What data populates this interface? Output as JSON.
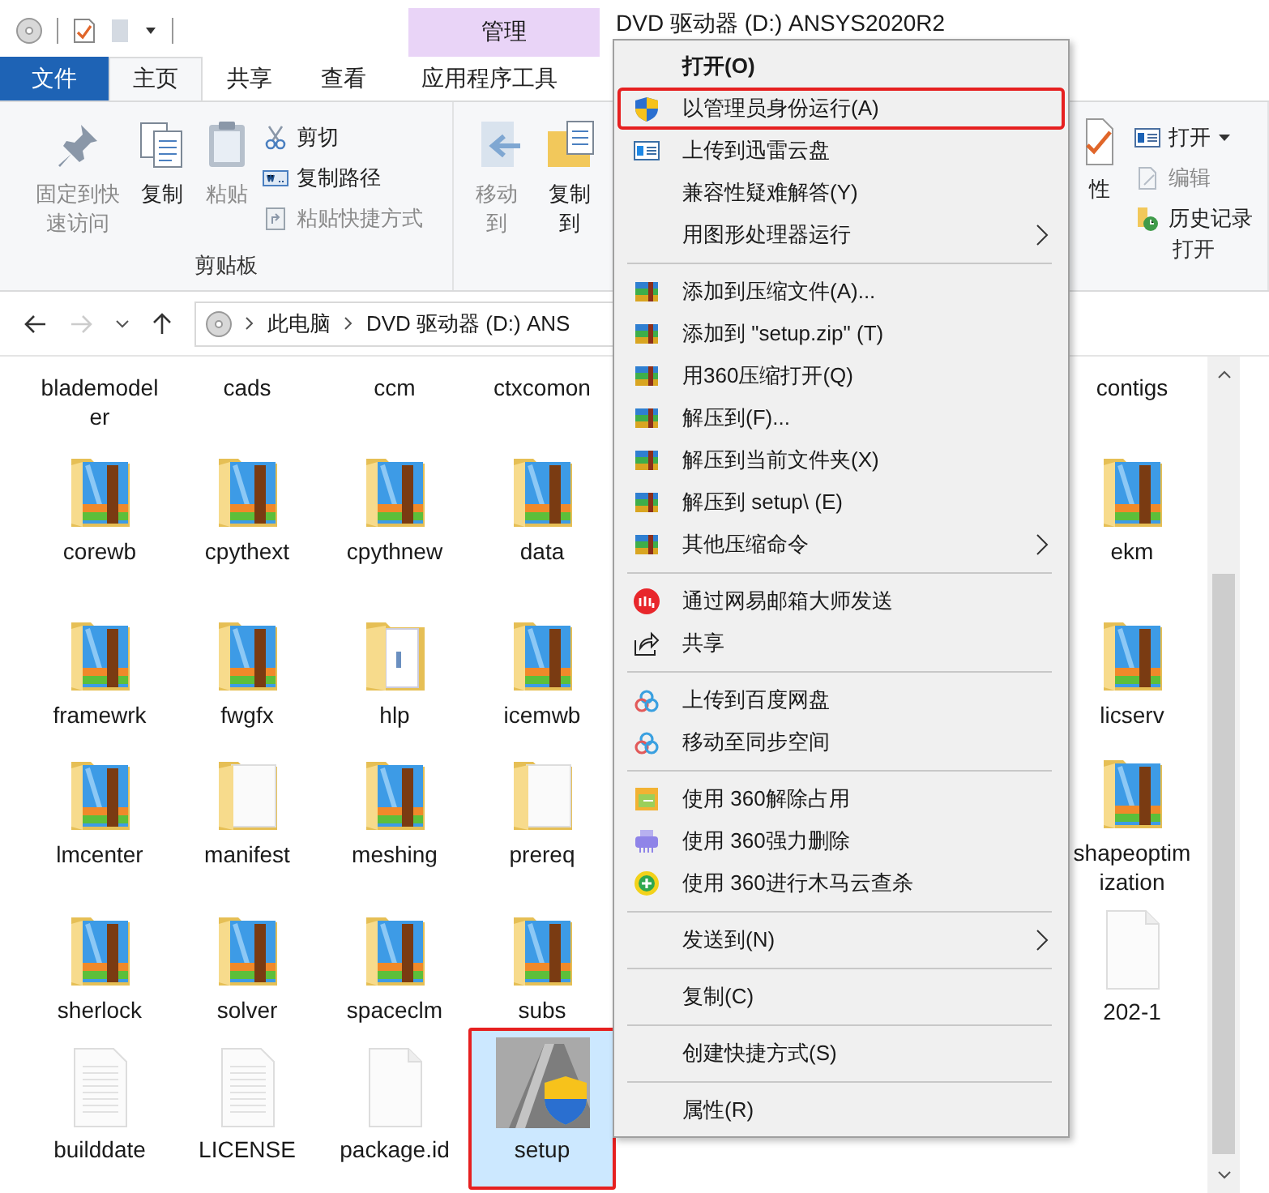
{
  "window": {
    "title": "DVD 驱动器 (D:) ANSYS2020R2",
    "context_header": "管理"
  },
  "tabs": [
    {
      "label": "文件",
      "kind": "file",
      "selected": false
    },
    {
      "label": "主页",
      "kind": "tab",
      "selected": true
    },
    {
      "label": "共享",
      "kind": "tab",
      "selected": false
    },
    {
      "label": "查看",
      "kind": "tab",
      "selected": false
    },
    {
      "label": "应用程序工具",
      "kind": "contextual",
      "selected": false
    }
  ],
  "ribbon": {
    "clipboard": {
      "label": "剪贴板",
      "large": [
        {
          "label": "固定到快速访问",
          "kind": "pin",
          "disabled": true
        },
        {
          "label": "复制",
          "kind": "copy",
          "disabled": false
        },
        {
          "label": "粘贴",
          "kind": "paste",
          "disabled": true
        }
      ],
      "small": [
        {
          "label": "剪切",
          "kind": "cut",
          "disabled": false
        },
        {
          "label": "复制路径",
          "kind": "copy-path",
          "disabled": false
        },
        {
          "label": "粘贴快捷方式",
          "kind": "paste-shortcut",
          "disabled": true
        }
      ]
    },
    "organize": {
      "large": [
        {
          "label": "移动到",
          "kind": "move",
          "disabled": true
        },
        {
          "label": "复制到",
          "kind": "copy-to",
          "disabled": false
        }
      ]
    },
    "properties": {
      "label": "性"
    },
    "open": {
      "label": "打开",
      "small": [
        {
          "label": "打开",
          "kind": "open",
          "dropdown": true,
          "disabled": false
        },
        {
          "label": "编辑",
          "kind": "edit",
          "dropdown": false,
          "disabled": true
        },
        {
          "label": "历史记录",
          "kind": "history",
          "dropdown": false,
          "disabled": false
        }
      ]
    }
  },
  "address": {
    "forward_disabled": true,
    "path": [
      "此电脑",
      "DVD 驱动器 (D:) ANS"
    ]
  },
  "files": [
    [
      {
        "name": "blademodeler",
        "kind": "none",
        "selected": false,
        "highlighted": false
      },
      {
        "name": "cads",
        "kind": "none",
        "selected": false,
        "highlighted": false
      },
      {
        "name": "ccm",
        "kind": "none",
        "selected": false,
        "highlighted": false
      },
      {
        "name": "ctxcomon",
        "kind": "none",
        "selected": false,
        "highlighted": false
      },
      {
        "name": "contigs",
        "kind": "none",
        "selected": false,
        "highlighted": false
      }
    ],
    [
      {
        "name": "corewb",
        "kind": "archive-folder",
        "selected": false,
        "highlighted": false
      },
      {
        "name": "cpythext",
        "kind": "archive-folder",
        "selected": false,
        "highlighted": false
      },
      {
        "name": "cpythnew",
        "kind": "archive-folder",
        "selected": false,
        "highlighted": false
      },
      {
        "name": "data",
        "kind": "archive-folder",
        "selected": false,
        "highlighted": false
      },
      {
        "name": "ekm",
        "kind": "archive-folder",
        "selected": false,
        "highlighted": false
      }
    ],
    [
      {
        "name": "framewrk",
        "kind": "archive-folder",
        "selected": false,
        "highlighted": false
      },
      {
        "name": "fwgfx",
        "kind": "archive-folder",
        "selected": false,
        "highlighted": false
      },
      {
        "name": "hlp",
        "kind": "doc-folder",
        "selected": false,
        "highlighted": false
      },
      {
        "name": "icemwb",
        "kind": "archive-folder",
        "selected": false,
        "highlighted": false
      },
      {
        "name": "licserv",
        "kind": "archive-folder",
        "selected": false,
        "highlighted": false
      }
    ],
    [
      {
        "name": "lmcenter",
        "kind": "archive-folder",
        "selected": false,
        "highlighted": false
      },
      {
        "name": "manifest",
        "kind": "paper-folder",
        "selected": false,
        "highlighted": false
      },
      {
        "name": "meshing",
        "kind": "archive-folder",
        "selected": false,
        "highlighted": false
      },
      {
        "name": "prereq",
        "kind": "paper-folder",
        "selected": false,
        "highlighted": false
      },
      {
        "name": "shapeoptimization",
        "kind": "archive-folder",
        "selected": false,
        "highlighted": false
      }
    ],
    [
      {
        "name": "sherlock",
        "kind": "archive-folder",
        "selected": false,
        "highlighted": false
      },
      {
        "name": "solver",
        "kind": "archive-folder",
        "selected": false,
        "highlighted": false
      },
      {
        "name": "spaceclm",
        "kind": "archive-folder",
        "selected": false,
        "highlighted": false
      },
      {
        "name": "subs",
        "kind": "archive-folder",
        "selected": false,
        "highlighted": false
      },
      {
        "name": "202-1",
        "kind": "blank-file",
        "selected": false,
        "highlighted": false
      }
    ],
    [
      {
        "name": "builddate",
        "kind": "text-file",
        "selected": false,
        "highlighted": false
      },
      {
        "name": "LICENSE",
        "kind": "text-file",
        "selected": false,
        "highlighted": false
      },
      {
        "name": "package.id",
        "kind": "blank-file",
        "selected": false,
        "highlighted": false
      },
      {
        "name": "setup",
        "kind": "installer",
        "selected": true,
        "highlighted": true
      }
    ]
  ],
  "context_menu": [
    [
      {
        "label": "打开(O)",
        "kind": "plain",
        "bold": true,
        "submenu": false,
        "highlighted": false
      },
      {
        "label": "以管理员身份运行(A)",
        "kind": "shield",
        "bold": false,
        "submenu": false,
        "highlighted": true
      },
      {
        "label": "上传到迅雷云盘",
        "kind": "window",
        "bold": false,
        "submenu": false,
        "highlighted": false
      },
      {
        "label": "兼容性疑难解答(Y)",
        "kind": "plain",
        "bold": false,
        "submenu": false,
        "highlighted": false
      },
      {
        "label": "用图形处理器运行",
        "kind": "plain",
        "bold": false,
        "submenu": true,
        "highlighted": false
      }
    ],
    [
      {
        "label": "添加到压缩文件(A)...",
        "kind": "archive",
        "bold": false,
        "submenu": false,
        "highlighted": false
      },
      {
        "label": "添加到 \"setup.zip\" (T)",
        "kind": "archive",
        "bold": false,
        "submenu": false,
        "highlighted": false
      },
      {
        "label": "用360压缩打开(Q)",
        "kind": "archive",
        "bold": false,
        "submenu": false,
        "highlighted": false
      },
      {
        "label": "解压到(F)...",
        "kind": "archive",
        "bold": false,
        "submenu": false,
        "highlighted": false
      },
      {
        "label": "解压到当前文件夹(X)",
        "kind": "archive",
        "bold": false,
        "submenu": false,
        "highlighted": false
      },
      {
        "label": "解压到 setup\\ (E)",
        "kind": "archive",
        "bold": false,
        "submenu": false,
        "highlighted": false
      },
      {
        "label": "其他压缩命令",
        "kind": "archive",
        "bold": false,
        "submenu": true,
        "highlighted": false
      }
    ],
    [
      {
        "label": "通过网易邮箱大师发送",
        "kind": "mail",
        "bold": false,
        "submenu": false,
        "highlighted": false
      },
      {
        "label": "共享",
        "kind": "share",
        "bold": false,
        "submenu": false,
        "highlighted": false
      }
    ],
    [
      {
        "label": "上传到百度网盘",
        "kind": "cloud",
        "bold": false,
        "submenu": false,
        "highlighted": false
      },
      {
        "label": "移动至同步空间",
        "kind": "cloud",
        "bold": false,
        "submenu": false,
        "highlighted": false
      }
    ],
    [
      {
        "label": "使用 360解除占用",
        "kind": "unlock",
        "bold": false,
        "submenu": false,
        "highlighted": false
      },
      {
        "label": "使用 360强力删除",
        "kind": "shred",
        "bold": false,
        "submenu": false,
        "highlighted": false
      },
      {
        "label": "使用 360进行木马云查杀",
        "kind": "scan",
        "bold": false,
        "submenu": false,
        "highlighted": false
      }
    ],
    [
      {
        "label": "发送到(N)",
        "kind": "plain",
        "bold": false,
        "submenu": true,
        "highlighted": false
      }
    ],
    [
      {
        "label": "复制(C)",
        "kind": "plain",
        "bold": false,
        "submenu": false,
        "highlighted": false
      }
    ],
    [
      {
        "label": "创建快捷方式(S)",
        "kind": "plain",
        "bold": false,
        "submenu": false,
        "highlighted": false
      }
    ],
    [
      {
        "label": "属性(R)",
        "kind": "plain",
        "bold": false,
        "submenu": false,
        "highlighted": false
      }
    ]
  ]
}
